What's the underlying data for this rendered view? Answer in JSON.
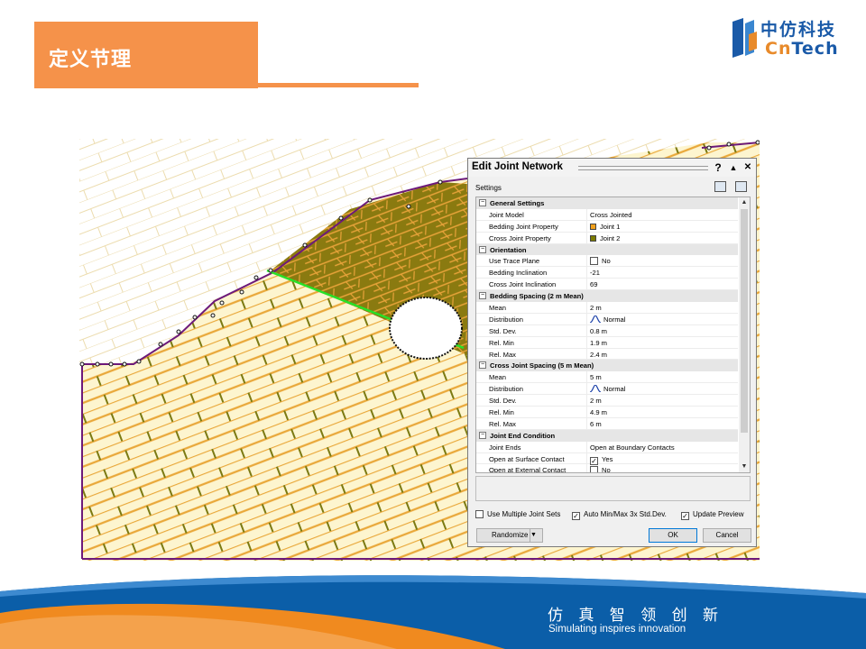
{
  "slide": {
    "title": "定义节理",
    "accent_color": "#f5924a"
  },
  "logo": {
    "cn_text": "中仿科技",
    "en_prefix": "Cn",
    "en_suffix": "Tech",
    "color": "#1a5aa8"
  },
  "dialog": {
    "title": "Edit Joint Network",
    "help_label": "?",
    "collapse_label": "▲",
    "close_label": "✕",
    "settings_label": "Settings",
    "sections": [
      {
        "title": "General Settings",
        "expander": "⊟",
        "props": [
          {
            "name": "Joint Model",
            "value": "Cross Jointed"
          },
          {
            "name": "Bedding Joint Property",
            "value": "Joint 1",
            "swatch": "#f2a11c"
          },
          {
            "name": "Cross Joint Property",
            "value": "Joint 2",
            "swatch": "#7a7a00"
          }
        ]
      },
      {
        "title": "Orientation",
        "expander": "⊟",
        "props": [
          {
            "name": "Use Trace Plane",
            "value": "No",
            "checkbox": false
          },
          {
            "name": "Bedding Inclination",
            "value": "-21"
          },
          {
            "name": "Cross Joint Inclination",
            "value": "69"
          }
        ]
      },
      {
        "title": "Bedding Spacing  (2 m  Mean)",
        "expander": "⊟",
        "props": [
          {
            "name": "Mean",
            "value": "2 m"
          },
          {
            "name": "Distribution",
            "value": "Normal",
            "dist_icon": true
          },
          {
            "name": "Std. Dev.",
            "value": "0.8 m"
          },
          {
            "name": "Rel. Min",
            "value": "1.9 m"
          },
          {
            "name": "Rel. Max",
            "value": "2.4 m"
          }
        ]
      },
      {
        "title": "Cross Joint Spacing  (5 m  Mean)",
        "expander": "⊟",
        "props": [
          {
            "name": "Mean",
            "value": "5 m"
          },
          {
            "name": "Distribution",
            "value": "Normal",
            "dist_icon": true
          },
          {
            "name": "Std. Dev.",
            "value": "2 m"
          },
          {
            "name": "Rel. Min",
            "value": "4.9 m"
          },
          {
            "name": "Rel. Max",
            "value": "6 m"
          }
        ]
      },
      {
        "title": "Joint End Condition",
        "expander": "⊟",
        "props": [
          {
            "name": "Joint Ends",
            "value": "Open at Boundary Contacts"
          },
          {
            "name": "Open at Surface Contact",
            "value": "Yes",
            "checkbox": true
          },
          {
            "name": "Open at External Contact",
            "value": "No",
            "checkbox": false
          }
        ]
      }
    ],
    "options": [
      {
        "label": "Use Multiple Joint Sets",
        "checked": false
      },
      {
        "label": "Auto Min/Max 3x Std.Dev.",
        "checked": true
      },
      {
        "label": "Update Preview",
        "checked": true
      }
    ],
    "randomize_label": "Randomize",
    "ok_label": "OK",
    "cancel_label": "Cancel"
  },
  "footer": {
    "slogan_cn": "仿 真 智 领 创 新",
    "slogan_en": "Simulating inspires innovation",
    "blue": "#0b5ea8",
    "orange": "#f08a1f"
  }
}
